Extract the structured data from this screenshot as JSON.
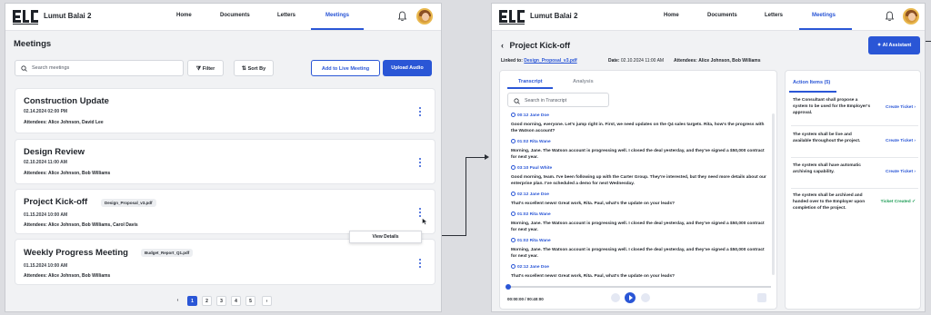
{
  "app": {
    "logo_text": "ELC",
    "brand": "Lumut Balai 2"
  },
  "nav": {
    "home": "Home",
    "documents": "Documents",
    "letters": "Letters",
    "meetings": "Meetings"
  },
  "list": {
    "title": "Meetings",
    "search_placeholder": "Search meetings",
    "filter_label": "Filter",
    "sort_label": "Sort By",
    "add_live_label": "Add to Live Meeting",
    "upload_label": "Upload Audio",
    "meetings": [
      {
        "title": "Construction Update",
        "datetime": "02.14.2024  02:00 PM",
        "attendees": "Attendees: Alice Johnson, David Lee",
        "attachment": ""
      },
      {
        "title": "Design Review",
        "datetime": "02.10.2024  11:00 AM",
        "attendees": "Attendees: Alice Johnson, Bob Williams",
        "attachment": ""
      },
      {
        "title": "Project Kick-off",
        "datetime": "01.15.2024  10:00 AM",
        "attendees": "Attendees: Alice Johnson, Bob Williams, Carol Davis",
        "attachment": "Design_Proposal_v3.pdf"
      },
      {
        "title": "Weekly Progress Meeting",
        "datetime": "01.15.2024  10:00 AM",
        "attendees": "Attendees: Alice Johnson, Bob Williams",
        "attachment": "Budget_Report_Q1.pdf"
      }
    ],
    "popup_label": "View Details",
    "pages": [
      "1",
      "2",
      "3",
      "4",
      "5"
    ],
    "prev_icon": "‹",
    "next_icon": "›"
  },
  "detail": {
    "title": "Project Kick-off",
    "linked_label": "Linked to:",
    "linked_file": "Design_Proposal_v3.pdf",
    "date_label": "Date:",
    "date_value": "02.10.2024  11:00 AM",
    "attendees_label": "Attendees:",
    "attendees_value": "Alice Johnson, Bob Williams",
    "ai_button": "AI Assistant",
    "tabs": {
      "transcript": "Transcript",
      "analysis": "Analysis"
    },
    "search_placeholder": "Search in Transcript",
    "transcript": [
      {
        "speaker": "00:12 Jane Doe",
        "text": "Good morning, everyone. Let's jump right in. First, we need updates on the Q4 sales targets. Rita, how's the progress with the Watson account?"
      },
      {
        "speaker": "01:02 Rita Wane",
        "text": "Morning, Jane. The Watson account is progressing well. I closed the deal yesterday, and they've signed a $50,000 contract for next year."
      },
      {
        "speaker": "03:10 Paul White",
        "text": "Good morning, team. I've been following up with the Carter Group. They're interested, but they need more details about our enterprise plan. I've scheduled a demo for next Wednesday."
      },
      {
        "speaker": "02:12 Jane Doe",
        "text": "That's excellent news! Great work, Rita. Paul, what's the update on your leads?"
      },
      {
        "speaker": "01:02 Rita Wane",
        "text": "Morning, Jane. The Watson account is progressing well. I closed the deal yesterday, and they've signed a $50,000 contract for next year."
      },
      {
        "speaker": "01:02 Rita Wane",
        "text": "Morning, Jane. The Watson account is progressing well. I closed the deal yesterday, and they've signed a $50,000 contract for next year."
      },
      {
        "speaker": "02:12 Jane Doe",
        "text": "That's excellent news! Great work, Rita. Paul, what's the update on your leads?"
      }
    ],
    "time": "00:00:00 / 00:40:00",
    "action_items_title": "Action Items (5)",
    "action_items": [
      {
        "text": "The Consultant shall propose a system to be used for the Employer's approval.",
        "cta": "Create Ticket ›"
      },
      {
        "text": "The system shall be live and available throughout the project.",
        "cta": "Create Ticket ›"
      },
      {
        "text": "The system shall have automatic archiving capability.",
        "cta": "Create Ticket ›"
      },
      {
        "text": "The system shall be archived and handed over to the Employer upon completion of the project.",
        "cta": "Ticket Created ✓"
      }
    ]
  },
  "colors": {
    "accent": "#2a56d6",
    "success": "#1f9d57",
    "bg": "#f1f2f4"
  }
}
